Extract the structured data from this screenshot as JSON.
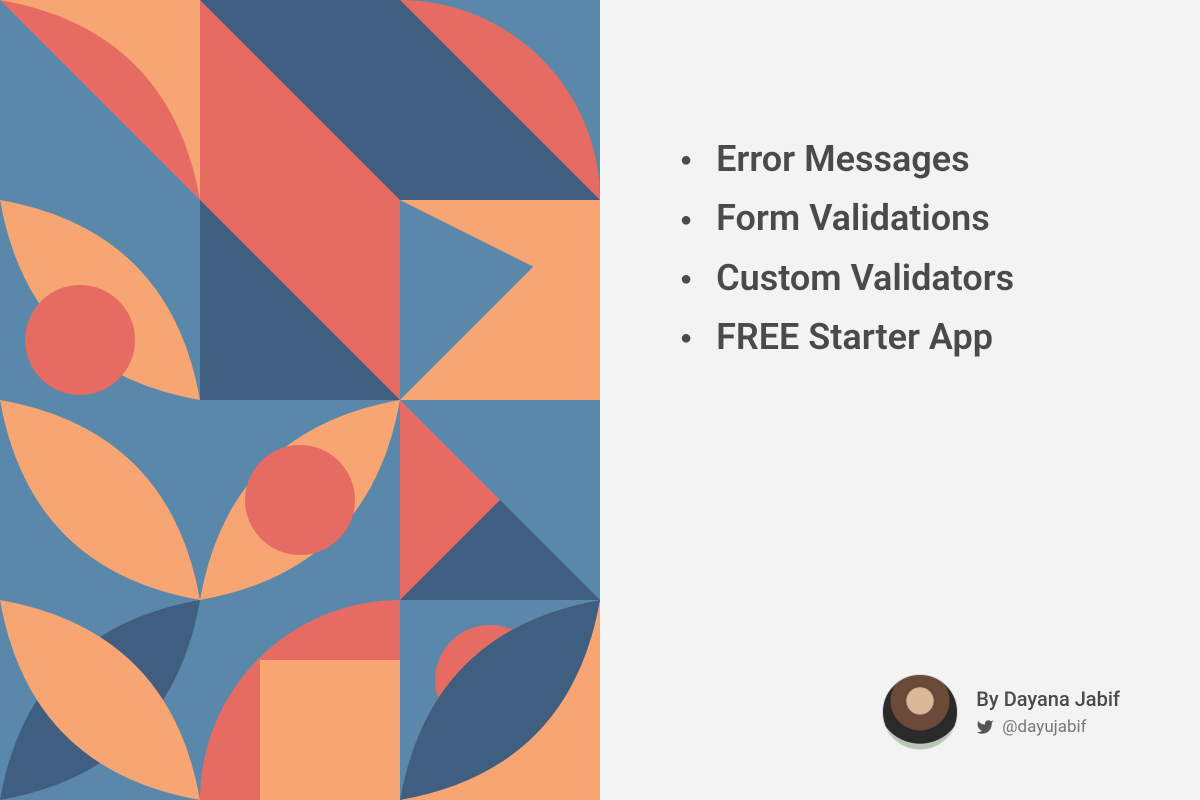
{
  "bullets": {
    "item0": "Error Messages",
    "item1": "Form Validations",
    "item2": "Custom Validators",
    "item3": "FREE Starter App"
  },
  "author": {
    "byline": "By Dayana Jabif",
    "handle": "@dayujabif"
  },
  "colors": {
    "blue_light": "#5988ab",
    "blue_dark": "#3f5e80",
    "coral": "#e66b62",
    "peach": "#f6a573"
  }
}
